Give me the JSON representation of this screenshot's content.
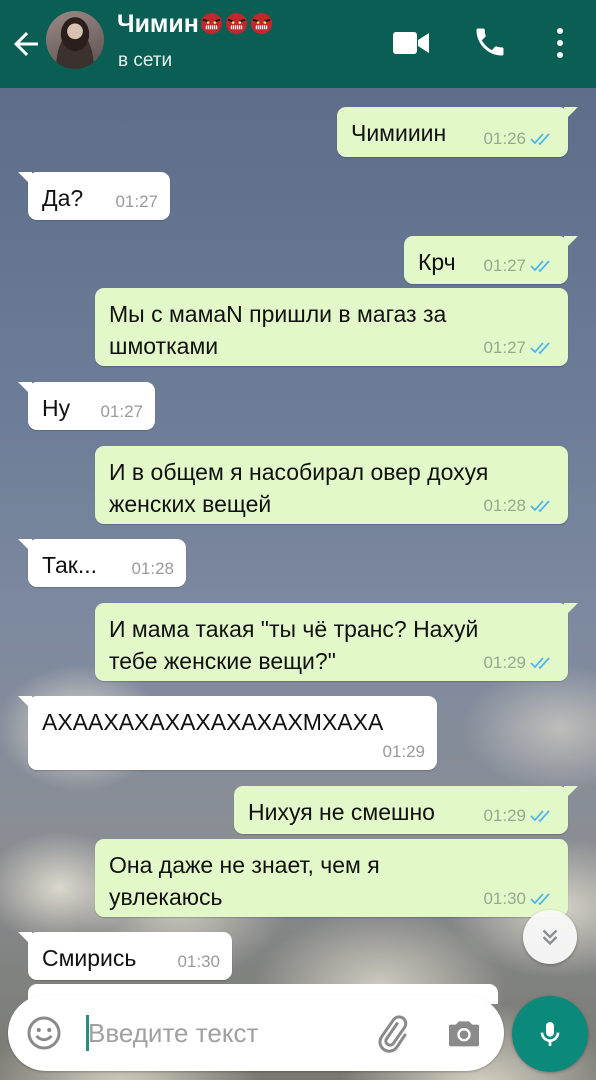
{
  "header": {
    "contact_name": "Чимин",
    "status": "в сети",
    "icons": [
      "back-arrow-icon",
      "goblin-emoji-icon",
      "video-call-icon",
      "phone-icon",
      "more-vert-icon"
    ]
  },
  "messages": [
    {
      "dir": "out",
      "text": "Чимииин",
      "time": "01:26",
      "read": true
    },
    {
      "dir": "in",
      "text": "Да?",
      "time": "01:27"
    },
    {
      "dir": "out",
      "text": "Крч",
      "time": "01:27",
      "read": true
    },
    {
      "dir": "out",
      "lines": [
        "Мы с мамаN пришли в магаз за",
        "шмотками"
      ],
      "time": "01:27",
      "read": true
    },
    {
      "dir": "in",
      "text": "Ну",
      "time": "01:27"
    },
    {
      "dir": "out",
      "lines": [
        "И в общем я насобирал овер дохуя",
        "женских вещей"
      ],
      "time": "01:28",
      "read": true
    },
    {
      "dir": "in",
      "text": "Так...",
      "time": "01:28"
    },
    {
      "dir": "out",
      "lines": [
        "И мама такая \"ты чё транс? Нахуй",
        "тебе женские вещи?\""
      ],
      "time": "01:29",
      "read": true
    },
    {
      "dir": "in",
      "text": "АХААХАХАХАХАХАХАХМХАХА",
      "time": "01:29"
    },
    {
      "dir": "out",
      "text": "Нихуя не смешно",
      "time": "01:29",
      "read": true
    },
    {
      "dir": "out",
      "lines": [
        "Она даже не знает, чем я",
        "увлекаюсь"
      ],
      "time": "01:30",
      "read": true
    },
    {
      "dir": "in",
      "text": "Смирись",
      "time": "01:30"
    }
  ],
  "composer": {
    "placeholder": "Введите текст",
    "icons": [
      "emoji-icon",
      "attach-icon",
      "camera-icon",
      "mic-icon"
    ]
  },
  "colors": {
    "header": "#0b5e53",
    "outgoing_bubble": "#e3f8c9",
    "incoming_bubble": "#ffffff",
    "read_ticks": "#4fb6ec",
    "mic_button": "#0b8a7b"
  }
}
